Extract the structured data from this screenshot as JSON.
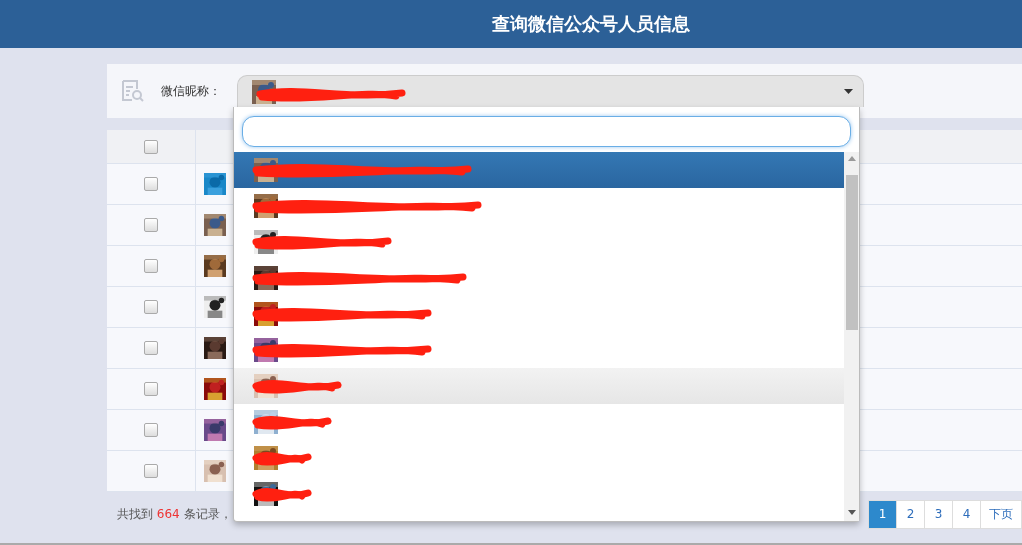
{
  "header": {
    "title": "查询微信公众号人员信息"
  },
  "search_bar": {
    "label": "微信昵称：",
    "select": {
      "redacted": true,
      "expanded": true
    }
  },
  "table": {
    "header_checkbox": {
      "checked": false
    },
    "rows": [
      {
        "checked": false
      },
      {
        "checked": false
      },
      {
        "checked": false
      },
      {
        "checked": false
      },
      {
        "checked": false
      },
      {
        "checked": false
      },
      {
        "checked": false
      },
      {
        "checked": false
      }
    ]
  },
  "footer": {
    "prefix": "共找到 ",
    "count": "664",
    "suffix": " 条记录，"
  },
  "pagination": [
    {
      "label": "1",
      "selected": true
    },
    {
      "label": "2",
      "selected": false
    },
    {
      "label": "3",
      "selected": false
    },
    {
      "label": "4",
      "selected": false
    },
    {
      "label": "下页",
      "selected": false
    }
  ],
  "dropdown": {
    "options": [
      {
        "redacted": true,
        "selected": true,
        "highlighted": false
      },
      {
        "redacted": true,
        "selected": false,
        "highlighted": false
      },
      {
        "redacted": true,
        "selected": false,
        "highlighted": false
      },
      {
        "redacted": true,
        "selected": false,
        "highlighted": false
      },
      {
        "redacted": true,
        "selected": false,
        "highlighted": false
      },
      {
        "redacted": true,
        "selected": false,
        "highlighted": false
      },
      {
        "redacted": true,
        "selected": false,
        "highlighted": true
      },
      {
        "redacted": true,
        "selected": false,
        "highlighted": false
      },
      {
        "redacted": true,
        "selected": false,
        "highlighted": false
      },
      {
        "redacted": true,
        "selected": false,
        "highlighted": false
      }
    ]
  }
}
